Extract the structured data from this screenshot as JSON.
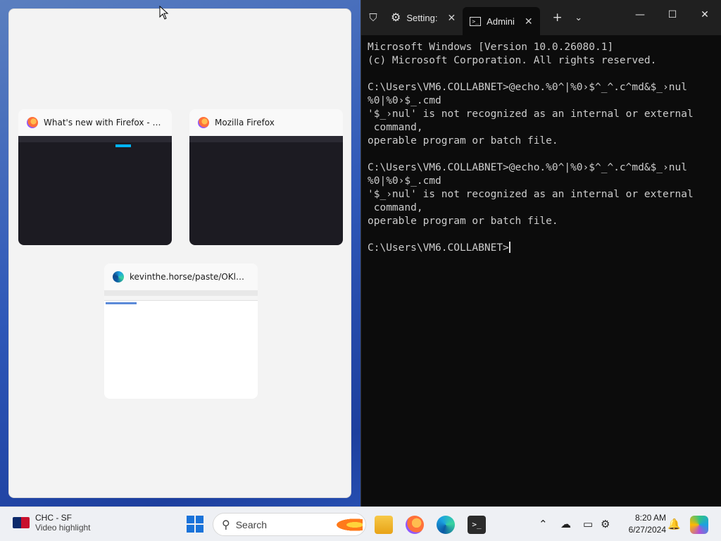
{
  "snap_assist": {
    "windows": [
      {
        "title": "What's new with Firefox - Mo...",
        "app_icon": "firefox-icon"
      },
      {
        "title": "Mozilla Firefox",
        "app_icon": "firefox-icon"
      },
      {
        "title": "kevinthe.horse/paste/OKl0WY...",
        "app_icon": "edge-icon"
      }
    ]
  },
  "terminal": {
    "tabs": [
      {
        "label": "Setting:",
        "icon": "gear-icon"
      },
      {
        "label": "Admini",
        "icon": "terminal-icon"
      }
    ],
    "new_tab_label": "+",
    "dropdown_label": "⌄",
    "lines": [
      "Microsoft Windows [Version 10.0.26080.1]",
      "(c) Microsoft Corporation. All rights reserved.",
      "",
      "C:\\Users\\VM6.COLLABNET>@echo.%0^|%0›$^_^.c^md&$_›nul",
      "%0|%0›$_.cmd",
      "'$_›nul' is not recognized as an internal or external",
      " command,",
      "operable program or batch file.",
      "",
      "C:\\Users\\VM6.COLLABNET>@echo.%0^|%0›$^_^.c^md&$_›nul",
      "%0|%0›$_.cmd",
      "'$_›nul' is not recognized as an internal or external",
      " command,",
      "operable program or batch file.",
      ""
    ],
    "prompt": "C:\\Users\\VM6.COLLABNET>"
  },
  "taskbar": {
    "widget": {
      "line1": "CHC - SF",
      "line2": "Video highlight"
    },
    "search_placeholder": "Search",
    "clock": {
      "time": "8:20 AM",
      "date": "6/27/2024"
    }
  }
}
